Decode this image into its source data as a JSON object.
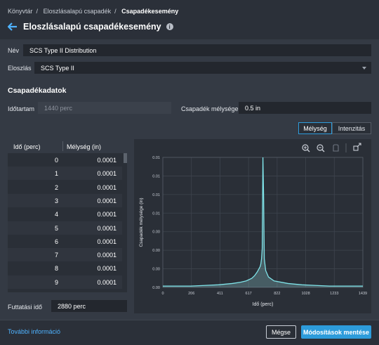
{
  "breadcrumb": {
    "items": [
      "Könyvtár",
      "Eloszlásalapú csapadék",
      "Csapadékesemény"
    ]
  },
  "header": {
    "title": "Eloszlásalapú csapadékesemény"
  },
  "form": {
    "name_label": "Név",
    "name_value": "SCS Type II Distribution",
    "distribution_label": "Eloszlás",
    "distribution_value": "SCS Type II"
  },
  "precip": {
    "section_title": "Csapadékadatok",
    "duration_label": "Időtartam",
    "duration_placeholder": "1440 perc",
    "depth_label": "Csapadék mélysége",
    "depth_value": "0.5 in"
  },
  "toggle": {
    "depth_label": "Mélység",
    "intensity_label": "Intenzitás",
    "selected": "Mélység"
  },
  "table": {
    "headers": [
      "Idő (perc)",
      "Mélység (in)"
    ],
    "rows": [
      [
        "0",
        "0.0001"
      ],
      [
        "1",
        "0.0001"
      ],
      [
        "2",
        "0.0001"
      ],
      [
        "3",
        "0.0001"
      ],
      [
        "4",
        "0.0001"
      ],
      [
        "5",
        "0.0001"
      ],
      [
        "6",
        "0.0001"
      ],
      [
        "7",
        "0.0001"
      ],
      [
        "8",
        "0.0001"
      ],
      [
        "9",
        "0.0001"
      ]
    ]
  },
  "run_time": {
    "label": "Futtatási idő",
    "value": "2880 perc"
  },
  "footer": {
    "more_info": "További információ",
    "cancel": "Mégse",
    "save": "Módosítások mentése"
  },
  "colors": {
    "accent": "#2d9cdb",
    "series": "#7fe3e8",
    "link": "#4fb3ff"
  },
  "chart_data": {
    "type": "area",
    "xlabel": "Idő (perc)",
    "ylabel": "Csapadék mélysége (in)",
    "xlim": [
      0,
      1439
    ],
    "ylim": [
      0,
      0.01
    ],
    "x_ticks": [
      "0",
      "206",
      "411",
      "617",
      "822",
      "1028",
      "1233",
      "1439"
    ],
    "y_ticks": [
      "0.00",
      "0.00",
      "0.00",
      "0.00",
      "0.01",
      "0.01",
      "0.01",
      "0.01"
    ],
    "grid": true,
    "x": [
      0,
      100,
      200,
      300,
      400,
      500,
      560,
      600,
      640,
      660,
      680,
      700,
      705,
      710,
      715,
      720,
      725,
      730,
      740,
      760,
      800,
      900,
      1000,
      1100,
      1200,
      1300,
      1439
    ],
    "values": [
      0.0001,
      0.0001,
      0.0001,
      0.00015,
      0.0002,
      0.0003,
      0.0004,
      0.0005,
      0.0007,
      0.0009,
      0.0012,
      0.0016,
      0.0018,
      0.0022,
      0.003,
      0.01,
      0.007,
      0.0022,
      0.0013,
      0.0008,
      0.0005,
      0.0003,
      0.0002,
      0.00015,
      0.0001,
      0.0001,
      0.0001
    ]
  }
}
